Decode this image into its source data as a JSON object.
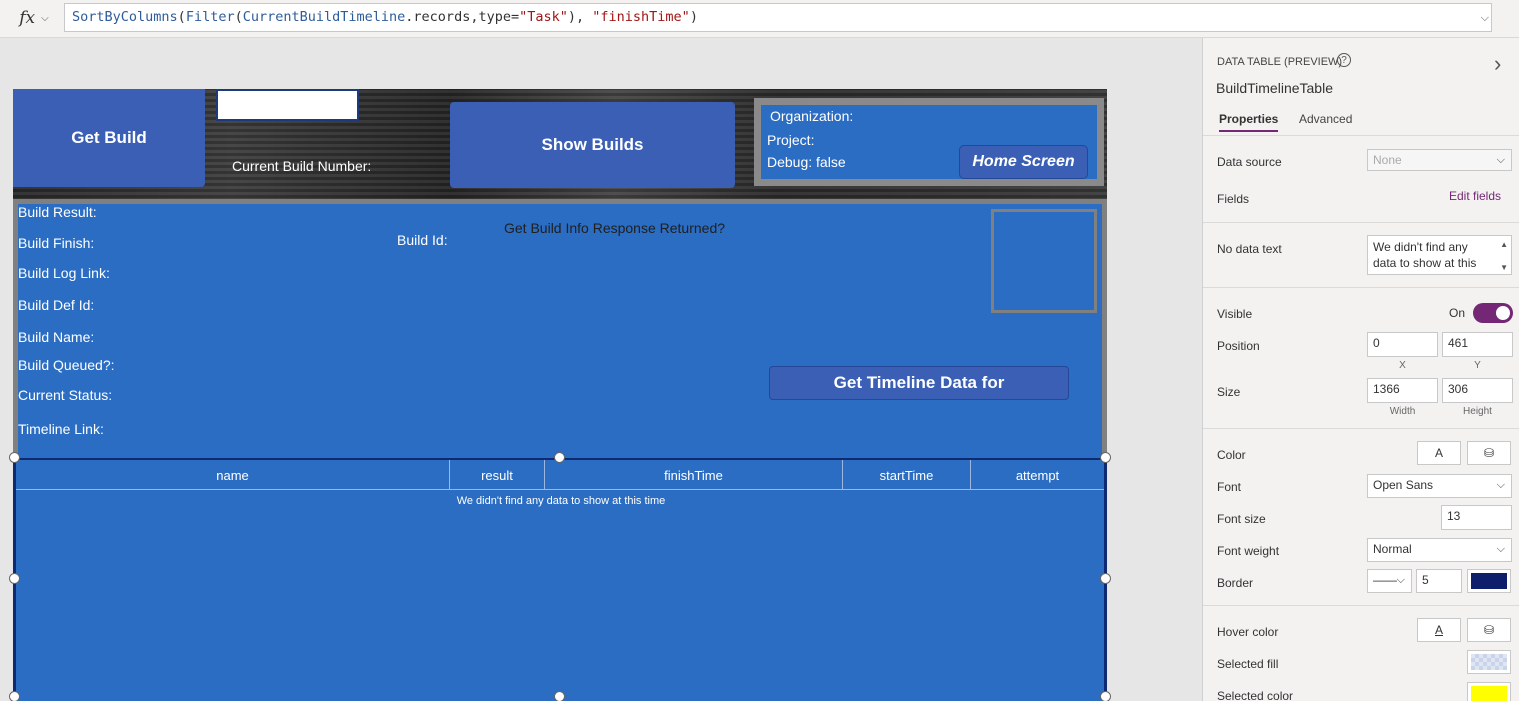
{
  "formula_bar": {
    "fx_label": "fx",
    "fx_chevron": "⌵",
    "formula_text": "SortByColumns(Filter(CurrentBuildTimeline.records,type=\"Task\"), \"finishTime\")",
    "expand_icon": "⌵"
  },
  "canvas": {
    "get_build_label": "Get Build",
    "current_build_number_label": "Current Build Number:",
    "show_builds_label": "Show Builds",
    "organization_label": "Organization:",
    "project_label": "Project:",
    "debug_label": "Debug: false",
    "home_screen_label": "Home Screen",
    "build_result_label": "Build Result:",
    "build_finish_label": "Build Finish:",
    "build_log_link_label": "Build Log Link:",
    "build_def_id_label": "Build Def Id:",
    "build_name_label": "Build Name:",
    "build_queued_label": "Build Queued?:",
    "current_status_label": "Current Status:",
    "timeline_link_label": "Timeline Link:",
    "build_id_label": "Build Id:",
    "response_label": "Get Build Info Response Returned?",
    "get_timeline_label": "Get Timeline Data for",
    "table": {
      "columns": [
        "name",
        "result",
        "finishTime",
        "startTime",
        "attempt"
      ],
      "no_data_text": "We didn't find any data to show at this time"
    }
  },
  "properties_pane": {
    "header": "DATA TABLE (PREVIEW)",
    "help_icon": "?",
    "collapse_icon": "›",
    "control_name": "BuildTimelineTable",
    "tabs": [
      "Properties",
      "Advanced"
    ],
    "active_tab": "Properties",
    "data_source_label": "Data source",
    "data_source_value": "None",
    "fields_label": "Fields",
    "edit_fields_label": "Edit fields",
    "no_data_text_label": "No data text",
    "no_data_text_value_line1": "We didn't find any",
    "no_data_text_value_line2": "data to show at this",
    "visible_label": "Visible",
    "visible_value": "On",
    "visible_on": true,
    "position_label": "Position",
    "position_x": "0",
    "position_y": "461",
    "x_label": "X",
    "y_label": "Y",
    "size_label": "Size",
    "size_width": "1366",
    "size_height": "306",
    "width_label": "Width",
    "height_label": "Height",
    "color_label": "Color",
    "color_text_glyph": "A",
    "color_fill_glyph": "⛁",
    "font_label": "Font",
    "font_value": "Open Sans",
    "font_size_label": "Font size",
    "font_size_value": "13",
    "font_weight_label": "Font weight",
    "font_weight_value": "Normal",
    "border_label": "Border",
    "border_style_glyph": "——",
    "border_width": "5",
    "border_color": "#0d1f6b",
    "hover_color_label": "Hover color",
    "selected_fill_label": "Selected fill",
    "selected_color_label": "Selected color",
    "selected_color": "#ffff00"
  },
  "colors": {
    "accent": "#742774",
    "button_blue": "#3a5fb5",
    "panel_blue": "#2a6dc2"
  }
}
